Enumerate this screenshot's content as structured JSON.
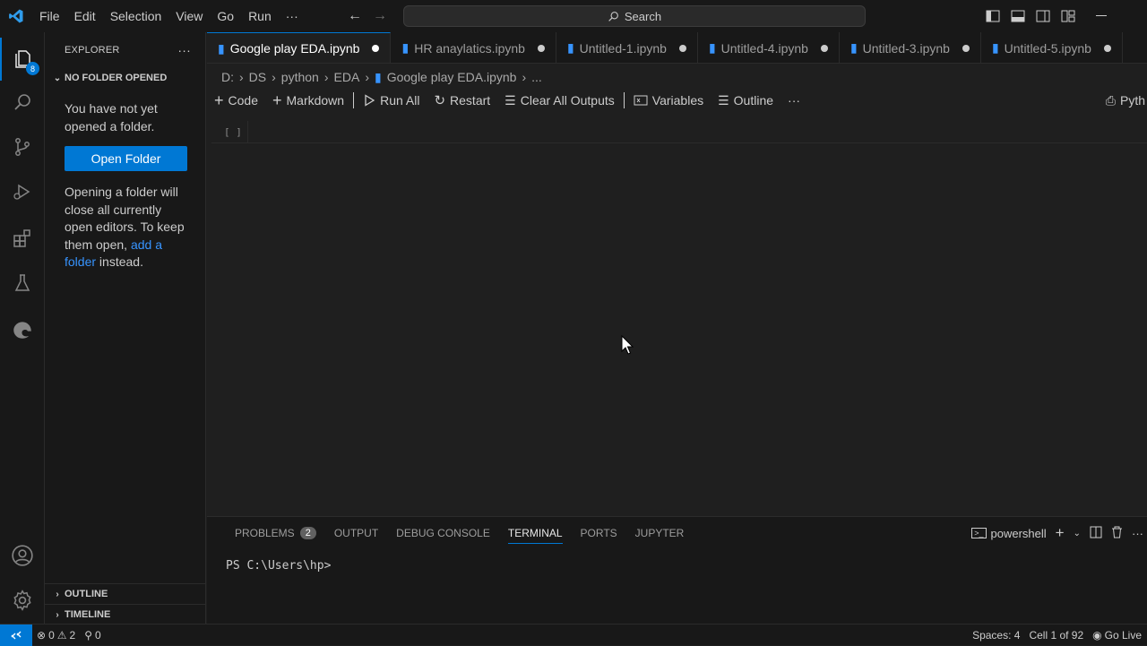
{
  "menu": [
    "File",
    "Edit",
    "Selection",
    "View",
    "Go",
    "Run",
    "···"
  ],
  "search": {
    "label": "Search"
  },
  "activity": {
    "explorer_badge": "8"
  },
  "sidebar": {
    "header": "EXPLORER",
    "more": "···",
    "section_title": "NO FOLDER OPENED",
    "msg1": "You have not yet opened a folder.",
    "open_button": "Open Folder",
    "msg2_before": "Opening a folder will close all currently open editors. To keep them open,",
    "msg2_link": "add a folder",
    "msg2_after": "instead.",
    "outline": "OUTLINE",
    "timeline": "TIMELINE"
  },
  "tabs": [
    {
      "label": "Google play EDA.ipynb",
      "active": true
    },
    {
      "label": "HR anaylatics.ipynb",
      "active": false
    },
    {
      "label": "Untitled-1.ipynb",
      "active": false
    },
    {
      "label": "Untitled-4.ipynb",
      "active": false
    },
    {
      "label": "Untitled-3.ipynb",
      "active": false
    },
    {
      "label": "Untitled-5.ipynb",
      "active": false
    }
  ],
  "breadcrumb": [
    "D:",
    "DS",
    "python",
    "EDA",
    "Google play EDA.ipynb",
    "..."
  ],
  "toolbar": {
    "code": "Code",
    "markdown": "Markdown",
    "run_all": "Run All",
    "restart": "Restart",
    "clear": "Clear All Outputs",
    "variables": "Variables",
    "outline": "Outline",
    "more": "···",
    "kernel": "Pyth"
  },
  "cell": {
    "gutter": "[ ]"
  },
  "panel": {
    "tabs": [
      "PROBLEMS",
      "OUTPUT",
      "DEBUG CONSOLE",
      "TERMINAL",
      "PORTS",
      "JUPYTER"
    ],
    "problems_count": "2",
    "active_tab": "TERMINAL",
    "shell": "powershell",
    "prompt": "PS C:\\Users\\hp>"
  },
  "status": {
    "errors": "0",
    "warnings": "2",
    "ports": "0",
    "spaces": "Spaces: 4",
    "cell": "Cell 1 of 92",
    "golive": "Go Live"
  },
  "colors": {
    "accent": "#0078d4",
    "bg": "#1f1f1f",
    "chrome": "#181818",
    "link": "#3794ff"
  }
}
